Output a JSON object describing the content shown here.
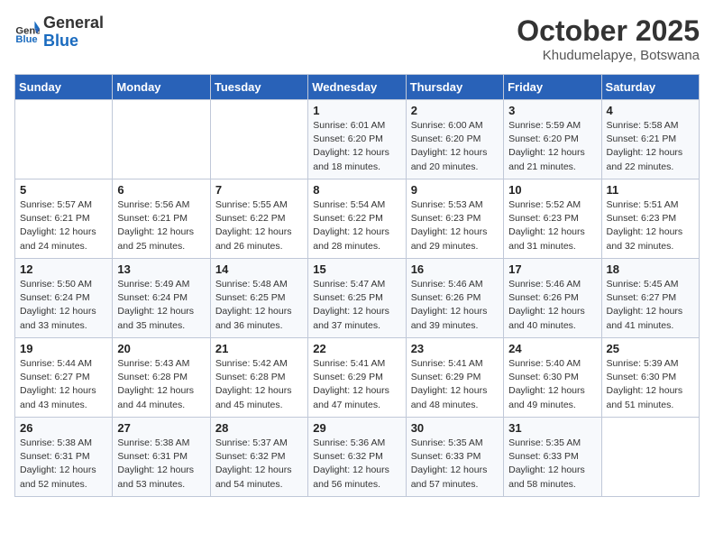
{
  "header": {
    "logo_general": "General",
    "logo_blue": "Blue",
    "month_title": "October 2025",
    "location": "Khudumelapye, Botswana"
  },
  "weekdays": [
    "Sunday",
    "Monday",
    "Tuesday",
    "Wednesday",
    "Thursday",
    "Friday",
    "Saturday"
  ],
  "weeks": [
    [
      {
        "day": "",
        "info": ""
      },
      {
        "day": "",
        "info": ""
      },
      {
        "day": "",
        "info": ""
      },
      {
        "day": "1",
        "info": "Sunrise: 6:01 AM\nSunset: 6:20 PM\nDaylight: 12 hours\nand 18 minutes."
      },
      {
        "day": "2",
        "info": "Sunrise: 6:00 AM\nSunset: 6:20 PM\nDaylight: 12 hours\nand 20 minutes."
      },
      {
        "day": "3",
        "info": "Sunrise: 5:59 AM\nSunset: 6:20 PM\nDaylight: 12 hours\nand 21 minutes."
      },
      {
        "day": "4",
        "info": "Sunrise: 5:58 AM\nSunset: 6:21 PM\nDaylight: 12 hours\nand 22 minutes."
      }
    ],
    [
      {
        "day": "5",
        "info": "Sunrise: 5:57 AM\nSunset: 6:21 PM\nDaylight: 12 hours\nand 24 minutes."
      },
      {
        "day": "6",
        "info": "Sunrise: 5:56 AM\nSunset: 6:21 PM\nDaylight: 12 hours\nand 25 minutes."
      },
      {
        "day": "7",
        "info": "Sunrise: 5:55 AM\nSunset: 6:22 PM\nDaylight: 12 hours\nand 26 minutes."
      },
      {
        "day": "8",
        "info": "Sunrise: 5:54 AM\nSunset: 6:22 PM\nDaylight: 12 hours\nand 28 minutes."
      },
      {
        "day": "9",
        "info": "Sunrise: 5:53 AM\nSunset: 6:23 PM\nDaylight: 12 hours\nand 29 minutes."
      },
      {
        "day": "10",
        "info": "Sunrise: 5:52 AM\nSunset: 6:23 PM\nDaylight: 12 hours\nand 31 minutes."
      },
      {
        "day": "11",
        "info": "Sunrise: 5:51 AM\nSunset: 6:23 PM\nDaylight: 12 hours\nand 32 minutes."
      }
    ],
    [
      {
        "day": "12",
        "info": "Sunrise: 5:50 AM\nSunset: 6:24 PM\nDaylight: 12 hours\nand 33 minutes."
      },
      {
        "day": "13",
        "info": "Sunrise: 5:49 AM\nSunset: 6:24 PM\nDaylight: 12 hours\nand 35 minutes."
      },
      {
        "day": "14",
        "info": "Sunrise: 5:48 AM\nSunset: 6:25 PM\nDaylight: 12 hours\nand 36 minutes."
      },
      {
        "day": "15",
        "info": "Sunrise: 5:47 AM\nSunset: 6:25 PM\nDaylight: 12 hours\nand 37 minutes."
      },
      {
        "day": "16",
        "info": "Sunrise: 5:46 AM\nSunset: 6:26 PM\nDaylight: 12 hours\nand 39 minutes."
      },
      {
        "day": "17",
        "info": "Sunrise: 5:46 AM\nSunset: 6:26 PM\nDaylight: 12 hours\nand 40 minutes."
      },
      {
        "day": "18",
        "info": "Sunrise: 5:45 AM\nSunset: 6:27 PM\nDaylight: 12 hours\nand 41 minutes."
      }
    ],
    [
      {
        "day": "19",
        "info": "Sunrise: 5:44 AM\nSunset: 6:27 PM\nDaylight: 12 hours\nand 43 minutes."
      },
      {
        "day": "20",
        "info": "Sunrise: 5:43 AM\nSunset: 6:28 PM\nDaylight: 12 hours\nand 44 minutes."
      },
      {
        "day": "21",
        "info": "Sunrise: 5:42 AM\nSunset: 6:28 PM\nDaylight: 12 hours\nand 45 minutes."
      },
      {
        "day": "22",
        "info": "Sunrise: 5:41 AM\nSunset: 6:29 PM\nDaylight: 12 hours\nand 47 minutes."
      },
      {
        "day": "23",
        "info": "Sunrise: 5:41 AM\nSunset: 6:29 PM\nDaylight: 12 hours\nand 48 minutes."
      },
      {
        "day": "24",
        "info": "Sunrise: 5:40 AM\nSunset: 6:30 PM\nDaylight: 12 hours\nand 49 minutes."
      },
      {
        "day": "25",
        "info": "Sunrise: 5:39 AM\nSunset: 6:30 PM\nDaylight: 12 hours\nand 51 minutes."
      }
    ],
    [
      {
        "day": "26",
        "info": "Sunrise: 5:38 AM\nSunset: 6:31 PM\nDaylight: 12 hours\nand 52 minutes."
      },
      {
        "day": "27",
        "info": "Sunrise: 5:38 AM\nSunset: 6:31 PM\nDaylight: 12 hours\nand 53 minutes."
      },
      {
        "day": "28",
        "info": "Sunrise: 5:37 AM\nSunset: 6:32 PM\nDaylight: 12 hours\nand 54 minutes."
      },
      {
        "day": "29",
        "info": "Sunrise: 5:36 AM\nSunset: 6:32 PM\nDaylight: 12 hours\nand 56 minutes."
      },
      {
        "day": "30",
        "info": "Sunrise: 5:35 AM\nSunset: 6:33 PM\nDaylight: 12 hours\nand 57 minutes."
      },
      {
        "day": "31",
        "info": "Sunrise: 5:35 AM\nSunset: 6:33 PM\nDaylight: 12 hours\nand 58 minutes."
      },
      {
        "day": "",
        "info": ""
      }
    ]
  ]
}
